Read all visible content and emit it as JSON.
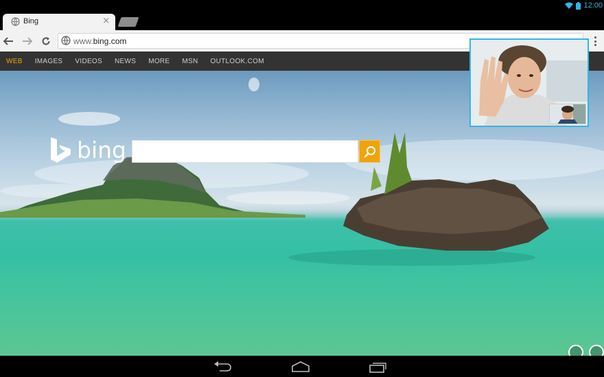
{
  "status": {
    "time": "12:00",
    "icons": [
      "wifi-icon",
      "battery-icon"
    ],
    "accent": "#33b5e5"
  },
  "tabs": [
    {
      "title": "Bing",
      "icon": "globe-icon",
      "active": true
    }
  ],
  "toolbar": {
    "url_prefix": "www.",
    "url_host": "bing.com",
    "icons": [
      "back-icon",
      "forward-icon",
      "reload-icon",
      "globe-icon",
      "menu-icon"
    ]
  },
  "bing": {
    "nav": [
      "WEB",
      "IMAGES",
      "VIDEOS",
      "NEWS",
      "MORE",
      "MSN",
      "OUTLOOK.COM"
    ],
    "active_nav": "WEB",
    "logo_text": "bing",
    "search_placeholder": "",
    "search_icon": "search-icon",
    "accent": "#f0a30a"
  },
  "video_call": {
    "border_color": "#33b5e5"
  },
  "system_nav": [
    "back-icon",
    "home-icon",
    "recents-icon"
  ]
}
